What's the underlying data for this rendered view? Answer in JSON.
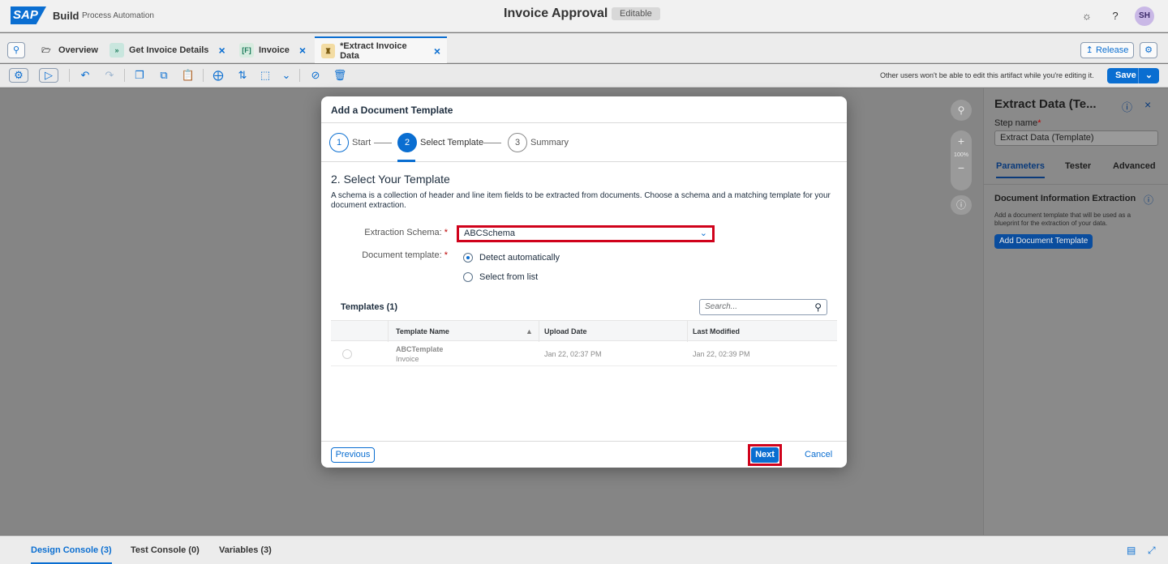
{
  "shell": {
    "logo": "SAP",
    "product": "Build",
    "product_sub": "Process Automation",
    "title": "Invoice Approval",
    "badge": "Editable",
    "avatar": "SH",
    "icons": [
      "feedback-icon",
      "help-icon"
    ]
  },
  "tabs": [
    {
      "label": "Overview",
      "icon": "folder-icon"
    },
    {
      "label": "Get Invoice Details",
      "icon": "trigger-icon"
    },
    {
      "label": "Invoice",
      "icon": "form-icon"
    },
    {
      "label": "*Extract Invoice Data",
      "icon": "document-ai-icon",
      "active": true
    }
  ],
  "tabbar_actions": {
    "release": "Release"
  },
  "toolbar": {
    "note": "Other users won't be able to edit this artifact while you're editing it.",
    "save": "Save"
  },
  "side_panel": {
    "title": "Extract Data (Te...",
    "step_name_label": "Step name",
    "step_name_value": "Extract Data (Template)",
    "tabs": [
      "Parameters",
      "Tester",
      "Advanced"
    ],
    "section": "Document Information Extraction",
    "description": "Add a document template that will be used as a blueprint for the extraction of your data.",
    "button": "Add Document Template"
  },
  "canvas": {
    "zoom": "100%"
  },
  "bottom_tabs": [
    "Design Console (3)",
    "Test Console (0)",
    "Variables (3)"
  ],
  "dialog": {
    "title": "Add a Document Template",
    "steps": [
      {
        "num": "1",
        "label": "Start"
      },
      {
        "num": "2",
        "label": "Select Template"
      },
      {
        "num": "3",
        "label": "Summary"
      }
    ],
    "section_title": "2. Select Your Template",
    "section_desc": "A schema is a collection of header and line item fields to be extracted from documents. Choose a schema and a matching template for your document extraction.",
    "schema_label": "Extraction Schema:",
    "schema_value": "ABCSchema",
    "template_label": "Document template:",
    "radio_options": [
      {
        "label": "Detect automatically",
        "checked": true
      },
      {
        "label": "Select from list",
        "checked": false
      }
    ],
    "table": {
      "title": "Templates (1)",
      "search_placeholder": "Search...",
      "columns": [
        "Template Name",
        "Upload Date",
        "Last Modified"
      ],
      "rows": [
        {
          "name": "ABCTemplate",
          "type": "Invoice",
          "upload": "Jan 22, 02:37 PM",
          "modified": "Jan 22, 02:39 PM"
        }
      ]
    },
    "footer": {
      "previous": "Previous",
      "next": "Next",
      "cancel": "Cancel"
    }
  }
}
